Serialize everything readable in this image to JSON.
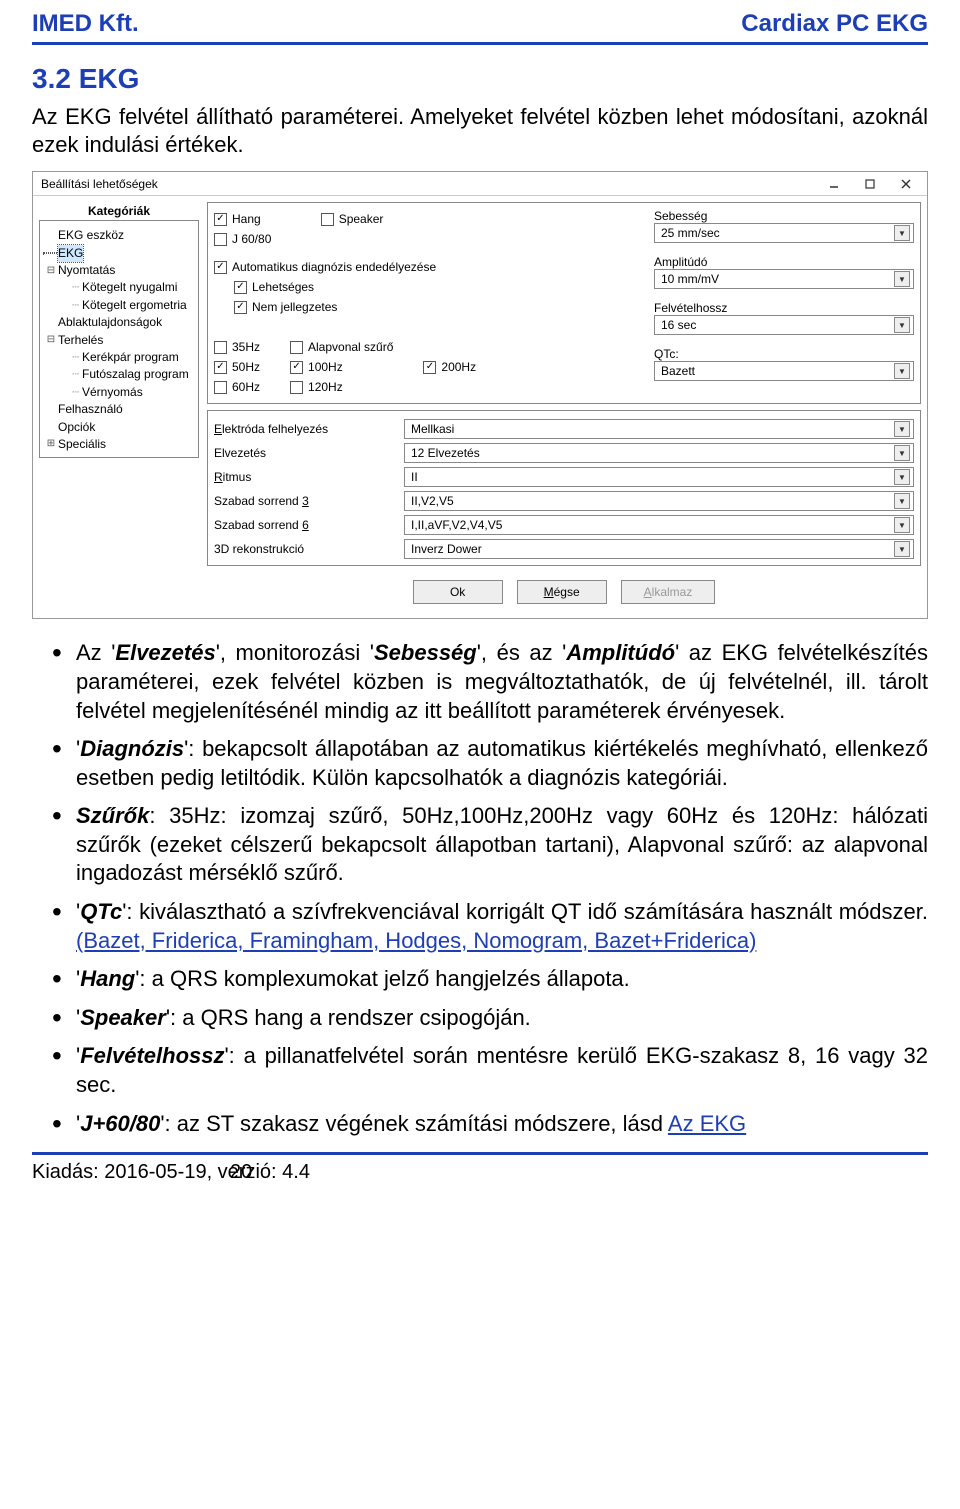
{
  "header": {
    "left": "IMED Kft.",
    "right": "Cardiax PC EKG"
  },
  "section": {
    "title": "3.2 EKG",
    "intro": "Az EKG felvétel állítható paraméterei. Amelyeket felvétel közben lehet módosítani, azoknál ezek indulási értékek."
  },
  "dialog": {
    "title": "Beállítási lehetőségek",
    "tree_header": "Kategóriák",
    "tree": [
      {
        "txt": "EKG eszköz",
        "lvl": 0,
        "exp": ""
      },
      {
        "txt": "EKG",
        "lvl": 0,
        "sel": true,
        "exp": ""
      },
      {
        "txt": "Nyomtatás",
        "lvl": 0,
        "exp": "−"
      },
      {
        "txt": "Kötegelt nyugalmi",
        "lvl": 1,
        "exp": ""
      },
      {
        "txt": "Kötegelt ergometria",
        "lvl": 1,
        "exp": ""
      },
      {
        "txt": "Ablaktulajdonságok",
        "lvl": 0,
        "exp": ""
      },
      {
        "txt": "Terhelés",
        "lvl": 0,
        "exp": "−"
      },
      {
        "txt": "Kerékpár program",
        "lvl": 1,
        "exp": ""
      },
      {
        "txt": "Futószalag program",
        "lvl": 1,
        "exp": ""
      },
      {
        "txt": "Vérnyomás",
        "lvl": 1,
        "exp": ""
      },
      {
        "txt": "Felhasználó",
        "lvl": 0,
        "exp": ""
      },
      {
        "txt": "Opciók",
        "lvl": 0,
        "exp": ""
      },
      {
        "txt": "Speciális",
        "lvl": 0,
        "exp": "+"
      }
    ],
    "checks_top": {
      "hang": "Hang",
      "speaker": "Speaker",
      "j6080": "J 60/80",
      "autodiag": "Automatikus diagnózis endedélyezése",
      "lehetseges": "Lehetséges",
      "nemjell": "Nem jellegzetes"
    },
    "filter_cols": [
      [
        "35Hz",
        "50Hz",
        "60Hz"
      ],
      [
        "Alapvonal szűrő",
        "100Hz",
        "120Hz"
      ],
      [
        "",
        "200Hz",
        ""
      ]
    ],
    "filter_checked": {
      "50Hz": true,
      "100Hz": true,
      "200Hz": true
    },
    "top_checked": {
      "hang": true,
      "autodiag": true,
      "lehetseges": true,
      "nemjell": true
    },
    "right_labels": {
      "seb": "Sebesség",
      "amp": "Amplitúdó",
      "felv": "Felvételhossz",
      "qtc": "QTc:"
    },
    "right_values": {
      "seb": "25 mm/sec",
      "amp": "10 mm/mV",
      "felv": "16 sec",
      "qtc": "Bazett"
    },
    "bottom": [
      {
        "label": "Elektróda felhelyezés",
        "value": "Mellkasi",
        "accel": "E"
      },
      {
        "label": "Elvezetés",
        "value": "12 Elvezetés",
        "accel": ""
      },
      {
        "label": "Ritmus",
        "value": "II",
        "accel": "R"
      },
      {
        "label": "Szabad sorrend 3",
        "value": "II,V2,V5",
        "accel": "3"
      },
      {
        "label": "Szabad sorrend 6",
        "value": "I,II,aVF,V2,V4,V5",
        "accel": "6"
      },
      {
        "label": "3D rekonstrukció",
        "value": "Inverz Dower",
        "accel": ""
      }
    ],
    "buttons": {
      "ok": "Ok",
      "cancel": "Mégse",
      "apply": "Alkalmaz",
      "cancel_accel": "M",
      "apply_accel": "A"
    }
  },
  "bullets": [
    {
      "html": "Az '<e>Elvezetés</e>', monitorozási '<e>Sebesség</e>', és az '<e>Amplitúdó</e>' az EKG felvételkészítés paraméterei, ezek felvétel közben is megváltoztathatók, de új felvételnél, ill. tárolt felvétel megjelenítésénél mindig az itt beállított paraméterek érvényesek."
    },
    {
      "html": "'<e>Diagnózis</e>': bekapcsolt állapotában az automatikus kiértékelés meghívható, ellenkező esetben pedig letiltódik. Külön kapcsolhatók a diagnózis kategóriái."
    },
    {
      "html": "<e>Szűrők</e>: 35Hz: izomzaj szűrő, 50Hz,100Hz,200Hz vagy 60Hz és 120Hz: hálózati szűrők (ezeket célszerű bekapcsolt állapotban tartani), Alapvonal szűrő: az alapvonal ingadozást mérséklő szűrő."
    },
    {
      "html": "'<e>QTc</e>': kiválasztható a szívfrekvenciával korrigált QT idő számítására használt módszer. <a>(Bazet, Friderica, Framingham, Hodges, Nomogram, Bazet+Friderica)</a>"
    },
    {
      "html": "'<e>Hang</e>': a QRS komplexumokat jelző hangjelzés állapota."
    },
    {
      "html": "'<e>Speaker</e>': a QRS hang a rendszer csipogóján."
    },
    {
      "html": "'<e>Felvételhossz</e>': a pillanatfelvétel során mentésre kerülő EKG-szakasz 8, 16 vagy 32 sec."
    },
    {
      "html": "'<e>J+60/80</e>': az ST szakasz végének számítási módszere, lásd <a>Az EKG</a>"
    }
  ],
  "footer": {
    "issue": "Kiadás: 2016-05-19, verzió: 4.4",
    "page": "20"
  }
}
